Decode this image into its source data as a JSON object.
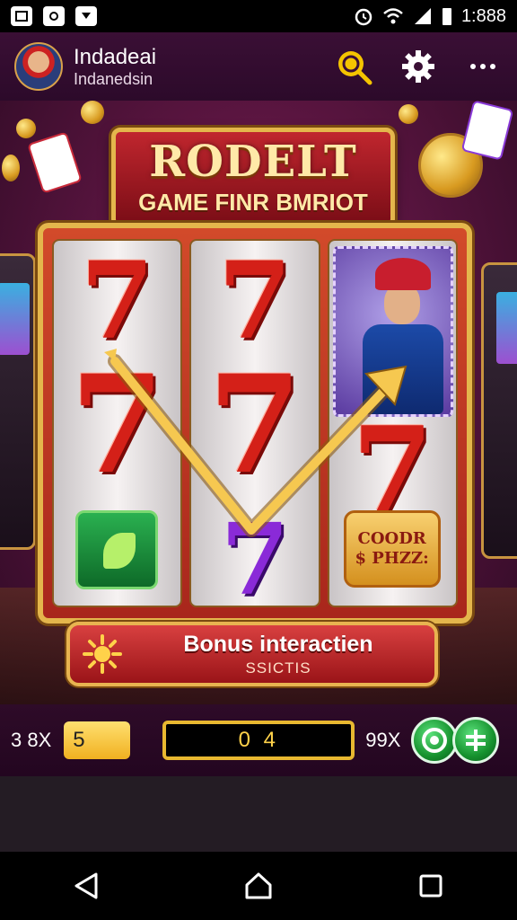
{
  "statusbar": {
    "time": "1:888"
  },
  "header": {
    "title": "Indadeai",
    "subtitle": "Indanedsin"
  },
  "game": {
    "title": "RODELT",
    "subtitle": "GAME FINR BMRIOT",
    "reels": [
      {
        "top": "7",
        "middle": "7"
      },
      {
        "top": "7",
        "middle": "7",
        "bottom": "7"
      },
      {
        "middle": "7"
      }
    ],
    "plaque": {
      "line1": "COODR",
      "line2": "$ PHZZ:"
    },
    "bonus": {
      "title": "Bonus interactien",
      "subtitle": "SSICTIS"
    }
  },
  "controls": {
    "left_multiplier": "3 8X",
    "bet_value": "5",
    "credits": "0 4",
    "right_multiplier": "99X"
  },
  "colors": {
    "accent_gold": "#e4b64c",
    "frame_red": "#c0262e",
    "control_green": "#16922e"
  }
}
